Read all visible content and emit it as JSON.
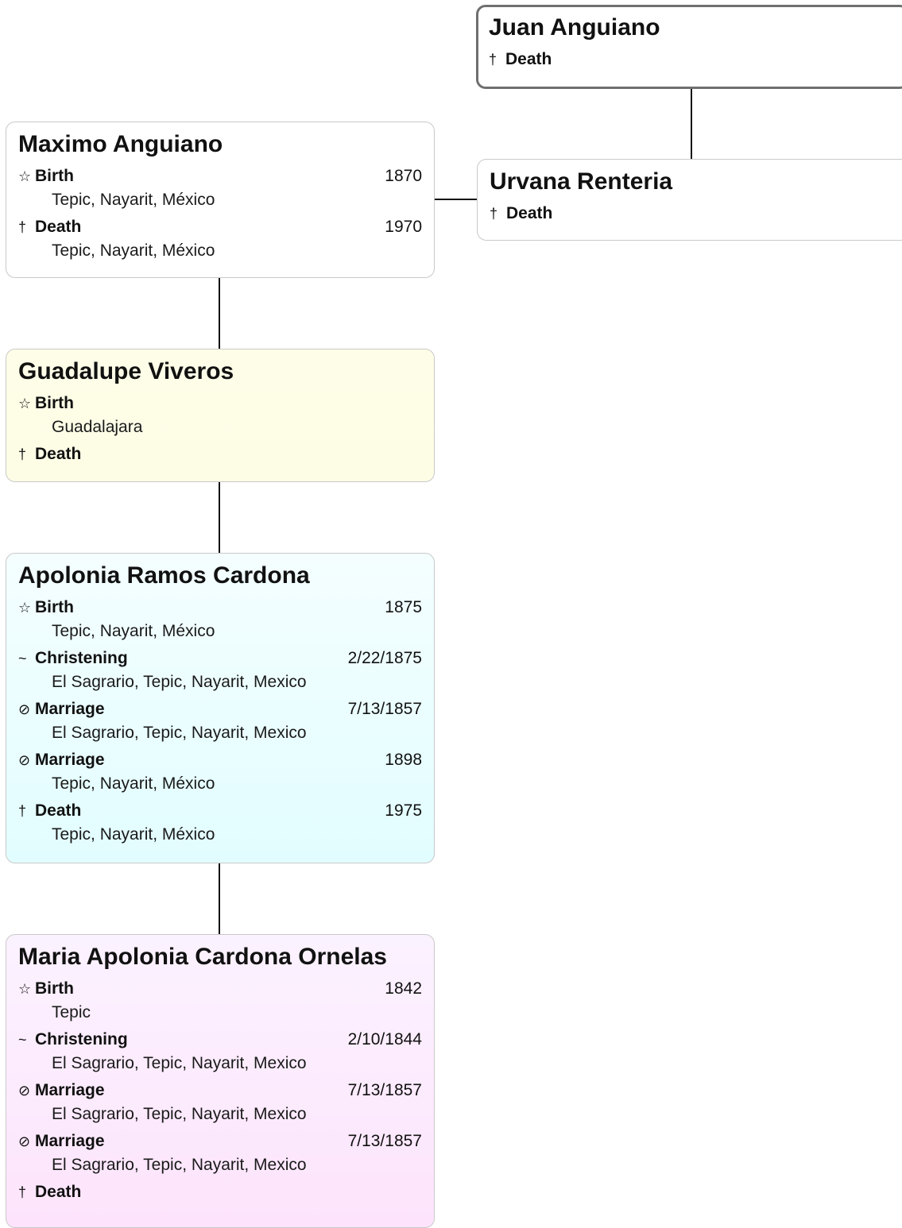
{
  "people": [
    {
      "name": "Juan Anguiano",
      "events": [
        {
          "icon": "cross-icon",
          "symbol": "†",
          "type": "Death",
          "date": "",
          "place": ""
        }
      ]
    },
    {
      "name": "Maximo Anguiano",
      "events": [
        {
          "icon": "star-icon",
          "symbol": "☆",
          "type": "Birth",
          "date": "1870",
          "place": "Tepic, Nayarit, México"
        },
        {
          "icon": "cross-icon",
          "symbol": "†",
          "type": "Death",
          "date": "1970",
          "place": "Tepic, Nayarit, México"
        }
      ]
    },
    {
      "name": "Urvana Renteria",
      "events": [
        {
          "icon": "cross-icon",
          "symbol": "†",
          "type": "Death",
          "date": "",
          "place": ""
        }
      ]
    },
    {
      "name": "Guadalupe Viveros",
      "color": "#fdfde6",
      "events": [
        {
          "icon": "star-icon",
          "symbol": "☆",
          "type": "Birth",
          "date": "",
          "place": "Guadalajara"
        },
        {
          "icon": "cross-icon",
          "symbol": "†",
          "type": "Death",
          "date": "",
          "place": ""
        }
      ]
    },
    {
      "name": "Apolonia Ramos Cardona",
      "color": "#e2fdff",
      "events": [
        {
          "icon": "star-icon",
          "symbol": "☆",
          "type": "Birth",
          "date": "1875",
          "place": "Tepic, Nayarit, México"
        },
        {
          "icon": "tilde-icon",
          "symbol": "~",
          "type": "Christening",
          "date": "2/22/1875",
          "place": "El Sagrario, Tepic, Nayarit, Mexico"
        },
        {
          "icon": "rings-icon",
          "symbol": "⊘",
          "type": "Marriage",
          "date": "7/13/1857",
          "place": "El Sagrario, Tepic, Nayarit, Mexico"
        },
        {
          "icon": "rings-icon",
          "symbol": "⊘",
          "type": "Marriage",
          "date": "1898",
          "place": "Tepic, Nayarit, México"
        },
        {
          "icon": "cross-icon",
          "symbol": "†",
          "type": "Death",
          "date": "1975",
          "place": "Tepic, Nayarit, México"
        }
      ]
    },
    {
      "name": "Maria Apolonia Cardona Ornelas",
      "color": "#fde4fc",
      "events": [
        {
          "icon": "star-icon",
          "symbol": "☆",
          "type": "Birth",
          "date": "1842",
          "place": "Tepic"
        },
        {
          "icon": "tilde-icon",
          "symbol": "~",
          "type": "Christening",
          "date": "2/10/1844",
          "place": "El Sagrario, Tepic, Nayarit, Mexico"
        },
        {
          "icon": "rings-icon",
          "symbol": "⊘",
          "type": "Marriage",
          "date": "7/13/1857",
          "place": "El Sagrario, Tepic, Nayarit, Mexico"
        },
        {
          "icon": "rings-icon",
          "symbol": "⊘",
          "type": "Marriage",
          "date": "7/13/1857",
          "place": "El Sagrario, Tepic, Nayarit, Mexico"
        },
        {
          "icon": "cross-icon",
          "symbol": "†",
          "type": "Death",
          "date": "",
          "place": ""
        }
      ]
    }
  ]
}
